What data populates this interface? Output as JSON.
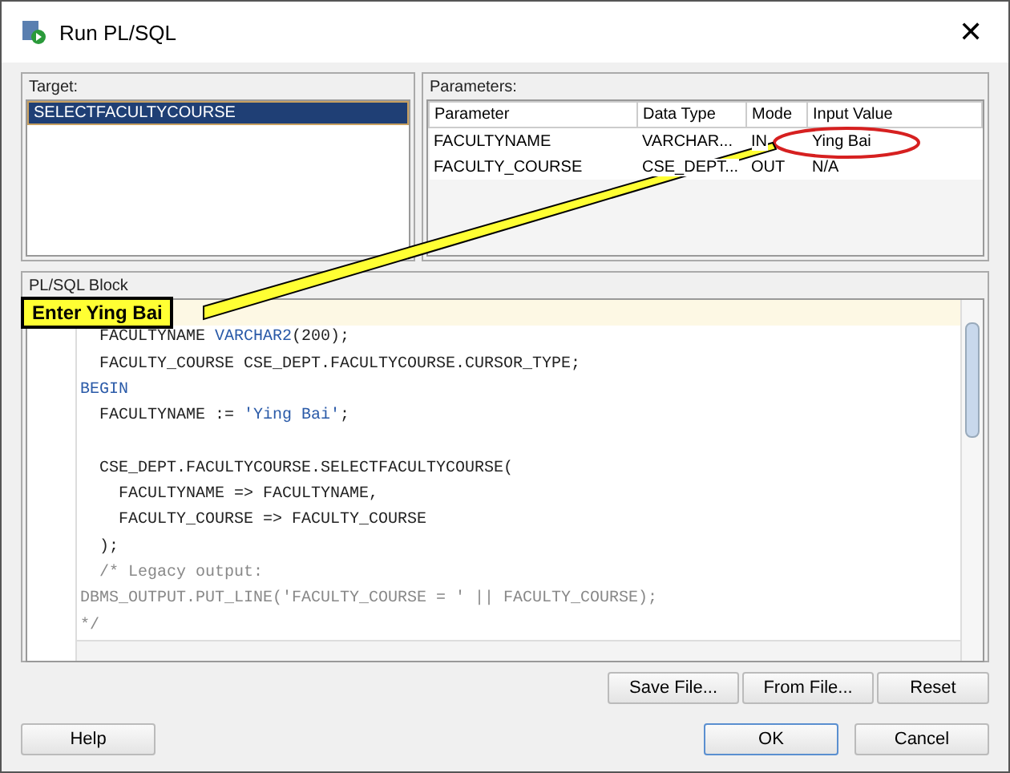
{
  "window": {
    "title": "Run PL/SQL",
    "close": "✕"
  },
  "target": {
    "label": "Target:",
    "items": [
      {
        "label": "SELECTFACULTYCOURSE",
        "selected": true
      }
    ]
  },
  "parameters": {
    "label": "Parameters:",
    "columns": [
      "Parameter",
      "Data Type",
      "Mode",
      "Input Value"
    ],
    "rows": [
      [
        "FACULTYNAME",
        "VARCHAR...",
        "IN",
        "Ying Bai"
      ],
      [
        "FACULTY_COURSE",
        "CSE_DEPT...",
        "OUT",
        "N/A"
      ]
    ]
  },
  "plsql_block": {
    "label": "PL/SQL Block",
    "lines": [
      {
        "kind": "blank",
        "current": true
      },
      {
        "segments": [
          {
            "text": "  FACULTYNAME ",
            "kind": "plain"
          },
          {
            "text": "VARCHAR2",
            "kind": "keyword"
          },
          {
            "text": "(200);",
            "kind": "plain"
          }
        ]
      },
      {
        "segments": [
          {
            "text": "  FACULTY_COURSE CSE_DEPT.FACULTYCOURSE.CURSOR_TYPE;",
            "kind": "plain"
          }
        ]
      },
      {
        "segments": [
          {
            "text": "BEGIN",
            "kind": "keyword"
          }
        ]
      },
      {
        "segments": [
          {
            "text": "  FACULTYNAME := ",
            "kind": "plain"
          },
          {
            "text": "'Ying Bai'",
            "kind": "string"
          },
          {
            "text": ";",
            "kind": "plain"
          }
        ]
      },
      {
        "kind": "blank",
        "current": false
      },
      {
        "segments": [
          {
            "text": "  CSE_DEPT.FACULTYCOURSE.SELECTFACULTYCOURSE(",
            "kind": "plain"
          }
        ]
      },
      {
        "segments": [
          {
            "text": "    FACULTYNAME => FACULTYNAME,",
            "kind": "plain"
          }
        ]
      },
      {
        "segments": [
          {
            "text": "    FACULTY_COURSE => FACULTY_COURSE",
            "kind": "plain"
          }
        ]
      },
      {
        "segments": [
          {
            "text": "  );",
            "kind": "plain"
          }
        ]
      },
      {
        "segments": [
          {
            "text": "  /* Legacy output:",
            "kind": "comment"
          }
        ]
      },
      {
        "segments": [
          {
            "text": "DBMS_OUTPUT.PUT_LINE('FACULTY_COURSE = ' || FACULTY_COURSE);",
            "kind": "comment"
          }
        ]
      },
      {
        "segments": [
          {
            "text": "*/",
            "kind": "comment"
          }
        ]
      }
    ]
  },
  "file_buttons": [
    "Save File...",
    "From File...",
    "Reset"
  ],
  "help_button": "Help",
  "dialog_buttons": [
    {
      "label": "OK",
      "default": true
    },
    {
      "label": "Cancel",
      "default": false
    }
  ],
  "callout": {
    "text": "Enter Ying Bai"
  }
}
